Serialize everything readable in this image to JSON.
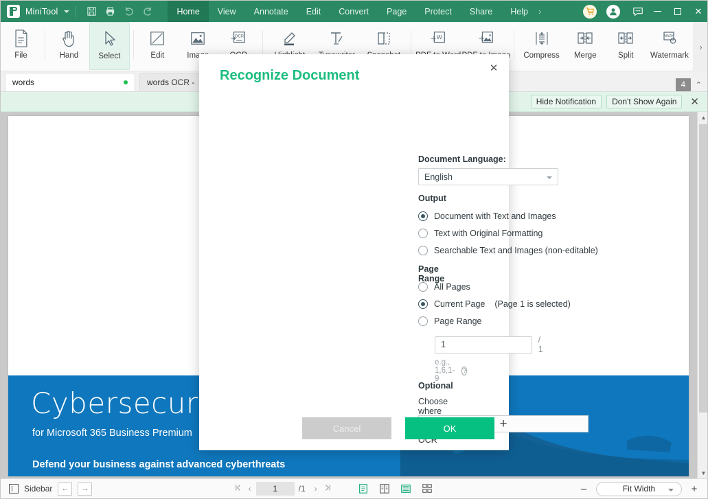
{
  "titlebar": {
    "brand": "MiniTool",
    "quick_actions": [
      {
        "name": "save-icon",
        "label": "Save"
      },
      {
        "name": "print-icon",
        "label": "Print"
      },
      {
        "name": "undo-icon",
        "label": "Undo"
      },
      {
        "name": "redo-icon",
        "label": "Redo"
      }
    ],
    "menus": [
      {
        "label": "Home",
        "active": true
      },
      {
        "label": "View",
        "active": false
      },
      {
        "label": "Annotate",
        "active": false
      },
      {
        "label": "Edit",
        "active": false
      },
      {
        "label": "Convert",
        "active": false
      },
      {
        "label": "Page",
        "active": false
      },
      {
        "label": "Protect",
        "active": false
      },
      {
        "label": "Share",
        "active": false
      },
      {
        "label": "Help",
        "active": false
      }
    ],
    "menu_overflow": "›",
    "right_icons": [
      {
        "name": "cart-icon"
      },
      {
        "name": "account-icon"
      },
      {
        "name": "feedback-icon"
      }
    ],
    "window_controls": {
      "minimize": "–",
      "maximize": "□",
      "close": "✕"
    },
    "colors": {
      "bar": "#2b8a64",
      "active_menu": "#207854"
    }
  },
  "ribbon": {
    "items": [
      {
        "label": "File",
        "icon": "file-icon",
        "selected": false
      },
      {
        "label": "Hand",
        "icon": "hand-icon",
        "selected": false
      },
      {
        "label": "Select",
        "icon": "cursor-icon",
        "selected": true
      },
      {
        "label": "Edit",
        "icon": "edit-icon",
        "selected": false
      },
      {
        "label": "Image",
        "icon": "image-icon",
        "selected": false
      },
      {
        "label": "OCR",
        "icon": "ocr-icon",
        "selected": false
      },
      {
        "label": "Highlight",
        "icon": "highlight-icon",
        "selected": false
      },
      {
        "label": "Typewriter",
        "icon": "typewriter-icon",
        "selected": false
      },
      {
        "label": "Snapshot",
        "icon": "snapshot-icon",
        "selected": false
      },
      {
        "label": "PDF to Word",
        "icon": "pdf-to-word-icon",
        "selected": false
      },
      {
        "label": "PDF to Image",
        "icon": "pdf-to-image-icon",
        "selected": false
      },
      {
        "label": "Compress",
        "icon": "compress-icon",
        "selected": false
      },
      {
        "label": "Merge",
        "icon": "merge-icon",
        "selected": false
      },
      {
        "label": "Split",
        "icon": "split-icon",
        "selected": false
      },
      {
        "label": "Watermark",
        "icon": "watermark-icon",
        "selected": false
      }
    ],
    "expand": "›"
  },
  "tabstrip": {
    "tabs": [
      {
        "label": "words",
        "active": true,
        "modified": true
      },
      {
        "label": "words OCR -",
        "active": false,
        "modified": false
      }
    ],
    "add": "+",
    "count": "4",
    "collapse": "⌃"
  },
  "notification": {
    "message": "",
    "buttons": [
      "Hide Notification",
      "Don't Show Again"
    ],
    "close": "✕"
  },
  "document": {
    "banner": {
      "title": "Cybersecurity",
      "subtitle": "for Microsoft 365 Business Premium",
      "tagline": "Defend your business against advanced cyberthreats",
      "background_color": "#0f77bd"
    }
  },
  "statusbar": {
    "sidebar_label": "Sidebar",
    "nav_prev": "←",
    "nav_next": "→",
    "first_page": "⏮",
    "prev_page": "‹",
    "current_page": "1",
    "total_pages": "/1",
    "next_page": "›",
    "last_page": "⏭",
    "view_modes": [
      {
        "name": "single-page-view-icon",
        "active": true
      },
      {
        "name": "two-page-view-icon",
        "active": false
      },
      {
        "name": "continuous-scroll-icon",
        "active": true
      },
      {
        "name": "grid-view-icon",
        "active": false
      }
    ],
    "zoom_out": "–",
    "zoom_level": "Fit Width",
    "zoom_in": "+"
  },
  "dialog": {
    "title": "Recognize Document",
    "close": "✕",
    "language_label": "Document Language:",
    "language_value": "English",
    "output_label": "Output",
    "output_options": [
      {
        "label": "Document with Text and Images",
        "selected": true
      },
      {
        "label": "Text with Original Formatting",
        "selected": false
      },
      {
        "label": "Searchable Text and Images (non-editable)",
        "selected": false
      }
    ],
    "page_range_label": "Page Range",
    "page_range_options": [
      {
        "label": "All Pages",
        "note": "",
        "selected": false
      },
      {
        "label": "Current Page",
        "note": "(Page 1 is selected)",
        "selected": true
      },
      {
        "label": "Page Range",
        "note": "",
        "selected": false
      }
    ],
    "page_input_value": "1",
    "page_input_total": "/ 1",
    "page_hint": "e.g., 1,6,1-9",
    "page_hint_help": "?",
    "optional_label": "Optional",
    "ocr_exclude_label": "Choose where not to perform OCR",
    "ocr_exclude_help": "?",
    "ocr_add": "+",
    "cancel_label": "Cancel",
    "ok_label": "OK",
    "colors": {
      "title": "#1bbd7e",
      "ok": "#05c081",
      "cancel": "#cccccc"
    }
  }
}
